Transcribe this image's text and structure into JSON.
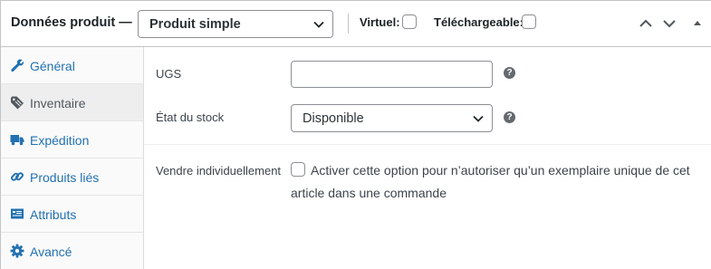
{
  "header": {
    "title": "Données produit —",
    "product_type": "Produit simple",
    "virtual_label": "Virtuel:",
    "downloadable_label": "Téléchargeable:"
  },
  "tabs": [
    {
      "label": "Général",
      "icon": "wrench-icon"
    },
    {
      "label": "Inventaire",
      "icon": "tag-icon",
      "active": true
    },
    {
      "label": "Expédition",
      "icon": "truck-icon"
    },
    {
      "label": "Produits liés",
      "icon": "link-icon"
    },
    {
      "label": "Attributs",
      "icon": "list-card-icon"
    },
    {
      "label": "Avancé",
      "icon": "gear-icon"
    }
  ],
  "inventory": {
    "sku_label": "UGS",
    "sku_value": "",
    "stock_label": "État du stock",
    "stock_value": "Disponible",
    "sold_individually_label": "Vendre individuellement",
    "sold_individually_text": "Activer cette option pour n’autoriser qu’un exemplaire unique de cet article dans une commande",
    "help_glyph": "?"
  },
  "colors": {
    "link": "#2271b1",
    "active_tab_bg": "#eeeeee",
    "border": "#c3c4c7",
    "help_icon": "#646970"
  }
}
